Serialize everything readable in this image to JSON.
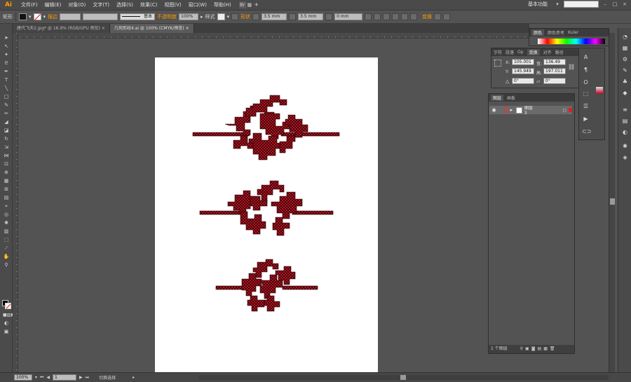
{
  "app": {
    "logo": "Ai",
    "accent": "#ff9a00"
  },
  "menu": [
    "文件(F)",
    "编辑(E)",
    "对象(O)",
    "文字(T)",
    "选择(S)",
    "效果(C)",
    "视图(V)",
    "窗口(W)",
    "帮助(H)"
  ],
  "menu_right": {
    "workspace": "基本功能",
    "workspace_arrow": "▾",
    "search_placeholder": ""
  },
  "control": {
    "selection": "矩形",
    "stroke_label": "描边",
    "stroke_style": "基本",
    "opacity_label": "不透明度",
    "opacity_value": "100%",
    "style_label": "样式",
    "shape_label": "形状",
    "w_value": "3.5 mm",
    "h_value": "3.5 mm",
    "r_value": "0 mm",
    "transform_label": "变换"
  },
  "tabs": [
    {
      "label": "唐代飞天2.jpg* @ 16.9% (RGB/GPU 预览)",
      "close": "×"
    },
    {
      "label": "几何形纹4.ai @ 100% (CMYK/预览)",
      "close": "×"
    }
  ],
  "panels": {
    "top_tabs": [
      "颜色",
      "颜色参考",
      "Kuler"
    ],
    "transform_tabs": [
      "字符",
      "段落",
      "Op",
      "变换",
      "对齐",
      "路径"
    ],
    "transform": {
      "x_label": "X:",
      "x": "105.001",
      "y_label": "Y:",
      "y": "145.949",
      "w_label": "宽:",
      "w": "136.49",
      "h_label": "高:",
      "h": "197.011",
      "angle": "0°",
      "shear": "0°"
    },
    "layers_tabs": [
      "图层",
      "画板"
    ],
    "layer_name": "图层 3",
    "layers_count": "1 个图层"
  },
  "status": {
    "zoom": "100%",
    "page": "1",
    "mode": "切换选择"
  },
  "artwork": {
    "fill": "#d01a2a",
    "outline": "#2a0004"
  }
}
